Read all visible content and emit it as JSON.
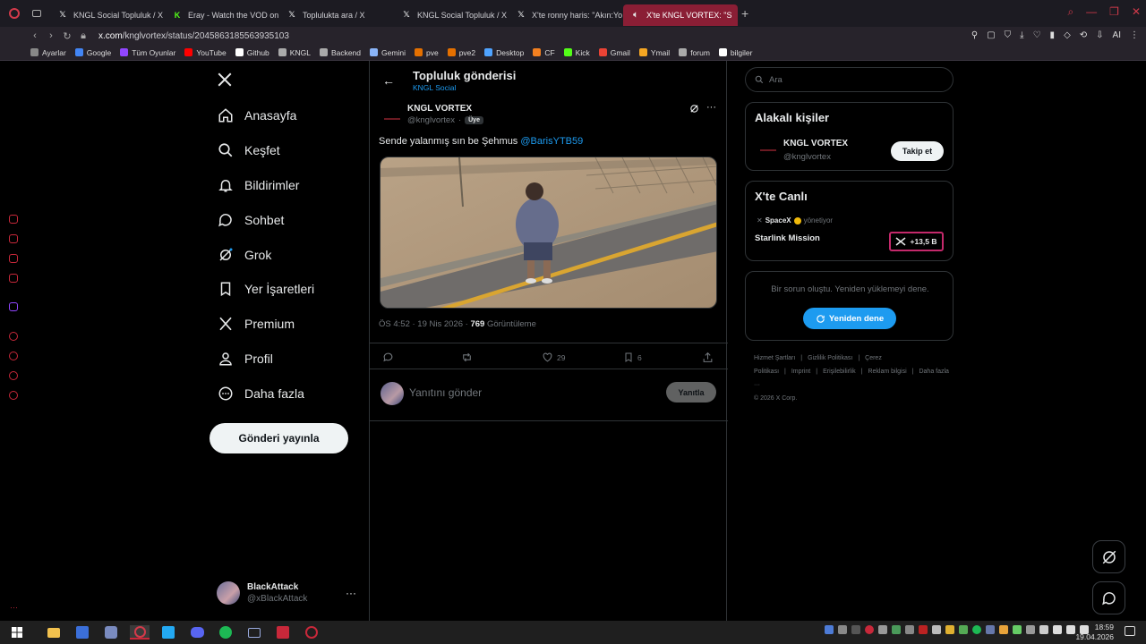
{
  "browser": {
    "tabs": [
      {
        "label": "KNGL Social Topluluk / X",
        "icon": "x-icon"
      },
      {
        "label": "Eray - Watch the VOD on K",
        "icon": "kick-icon"
      },
      {
        "label": "Toplulukta ara / X",
        "icon": "x-icon"
      },
      {
        "label": "KNGL Social Topluluk / X",
        "icon": "x-icon"
      },
      {
        "label": "X'te ronny haris: \"Akın:Yo",
        "icon": "x-icon"
      },
      {
        "label": "X'te KNGL VORTEX: \"S",
        "icon": "x-icon",
        "active": true
      }
    ],
    "url_host": "x.com",
    "url_path": "/knglvortex/status/2045863185563935103",
    "ai_label": "AI",
    "bookmarks": [
      {
        "label": "Ayarlar",
        "color": "#888888"
      },
      {
        "label": "Google",
        "color": "#4285f4"
      },
      {
        "label": "Tüm Oyunlar",
        "color": "#9146ff"
      },
      {
        "label": "YouTube",
        "color": "#ff0000"
      },
      {
        "label": "Github",
        "color": "#ffffff"
      },
      {
        "label": "KNGL",
        "color": "#aaaaaa"
      },
      {
        "label": "Backend",
        "color": "#aaaaaa"
      },
      {
        "label": "Gemini",
        "color": "#8ab4f8"
      },
      {
        "label": "pve",
        "color": "#e57000"
      },
      {
        "label": "pve2",
        "color": "#e57000"
      },
      {
        "label": "Desktop",
        "color": "#4fa3ff"
      },
      {
        "label": "CF",
        "color": "#f38020"
      },
      {
        "label": "Kick",
        "color": "#53fc18"
      },
      {
        "label": "Gmail",
        "color": "#ea4335"
      },
      {
        "label": "Ymail",
        "color": "#f5a623"
      },
      {
        "label": "forum",
        "color": "#aaaaaa"
      },
      {
        "label": "bilgiler",
        "color": "#ffffff"
      }
    ]
  },
  "nav": {
    "items": [
      {
        "label": "Anasayfa",
        "icon": "home-icon"
      },
      {
        "label": "Keşfet",
        "icon": "search-icon"
      },
      {
        "label": "Bildirimler",
        "icon": "bell-icon"
      },
      {
        "label": "Sohbet",
        "icon": "chat-icon"
      },
      {
        "label": "Grok",
        "icon": "grok-icon"
      },
      {
        "label": "Yer İşaretleri",
        "icon": "bookmark-icon"
      },
      {
        "label": "Premium",
        "icon": "x-icon"
      },
      {
        "label": "Profil",
        "icon": "user-icon"
      },
      {
        "label": "Daha fazla",
        "icon": "more-icon"
      }
    ],
    "post_button": "Gönderi yayınla",
    "account": {
      "name": "BlackAttack",
      "handle": "@xBlackAttack"
    }
  },
  "post": {
    "header_title": "Topluluk gönderisi",
    "header_sub": "KNGL Social",
    "author_name": "KNGL VORTEX",
    "author_handle": "@knglvortex",
    "separator": "·",
    "member_badge": "Üye",
    "text": "Sende yalanmış sın be Şehmus ",
    "mention": "@BarisYTB59",
    "time": "ÖS 4:52 · 19 Nis 2026 · ",
    "views_count": "769",
    "views_label": " Görüntüleme",
    "likes": "29",
    "bookmarks": "6",
    "reply_placeholder": "Yanıtını gönder",
    "reply_button": "Yanıtla"
  },
  "right": {
    "search_placeholder": "Ara",
    "relevant_title": "Alakalı kişiler",
    "relevant_name": "KNGL VORTEX",
    "relevant_handle": "@knglvortex",
    "follow_label": "Takip et",
    "live_title": "X'te Canlı",
    "live_host": "SpaceX",
    "live_host_role": "yönetiyor",
    "live_event": "Starlink Mission",
    "live_count": "+13,5 B",
    "error_text": "Bir sorun oluştu. Yeniden yüklemeyi dene.",
    "retry_label": "Yeniden dene",
    "footer_links": [
      "Hizmet Şartları",
      "|",
      "Gizlilik Politikası",
      "|",
      "Çerez Politikası",
      "|",
      "Imprint",
      "|",
      "Erişilebilirlik",
      "|",
      "Reklam bilgisi",
      "|",
      "Daha fazla ···"
    ],
    "copyright": "© 2026 X Corp."
  },
  "taskbar": {
    "time": "18:59",
    "date": "19.04.2026"
  },
  "colors": {
    "accent": "#1d9bf0",
    "browser_accent": "#8a1e35"
  }
}
